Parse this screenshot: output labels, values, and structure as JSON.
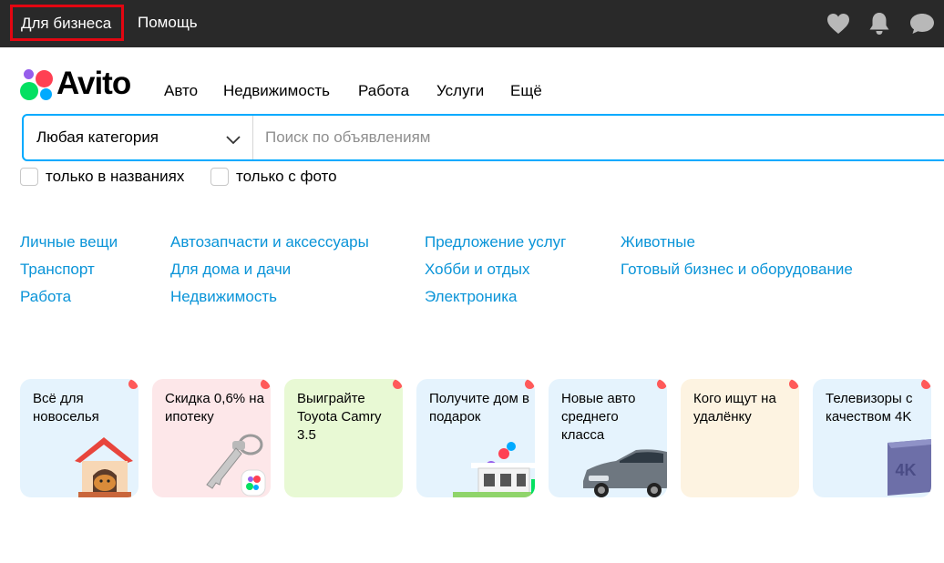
{
  "topbar": {
    "business_link": "Для бизнеса",
    "help_link": "Помощь",
    "icons": [
      "heart-icon",
      "bell-icon",
      "message-icon"
    ]
  },
  "logo": {
    "text": "Avito",
    "dot_colors": [
      "#965eeb",
      "#ff4053",
      "#04e061",
      "#0af"
    ]
  },
  "nav": [
    "Авто",
    "Недвижимость",
    "Работа",
    "Услуги",
    "Ещё"
  ],
  "search": {
    "category": "Любая категория",
    "placeholder": "Поиск по объявлениям"
  },
  "filters": {
    "titles_only": "только в названиях",
    "with_photo": "только с фото"
  },
  "categories": [
    [
      "Личные вещи",
      "Транспорт",
      "Работа"
    ],
    [
      "Автозапчасти и аксессуары",
      "Для дома и дачи",
      "Недвижимость"
    ],
    [
      "Предложение услуг",
      "Хобби и отдых",
      "Электроника"
    ],
    [
      "Животные",
      "Готовый бизнес и оборудование"
    ]
  ],
  "promo_cards": [
    {
      "title": "Всё для новоселья",
      "bg": "#e5f3fd",
      "image": "doghouse-image"
    },
    {
      "title": "Скидка 0,6% на ипотеку",
      "bg": "#fde7e9",
      "image": "keys-image"
    },
    {
      "title": "Выиграйте Toyota Camry 3.5",
      "bg": "#e8f9d4",
      "image": ""
    },
    {
      "title": "Получите дом в подарок",
      "bg": "#e5f3fd",
      "image": "house-image"
    },
    {
      "title": "Новые авто среднего класса",
      "bg": "#e5f3fd",
      "image": "car-image"
    },
    {
      "title": "Кого ищут на удалёнку",
      "bg": "#fdf3e1",
      "image": ""
    },
    {
      "title": "Телевизоры с качеством 4K",
      "bg": "#e5f3fd",
      "image": "tv-4k-image"
    }
  ],
  "tv_label": "4K",
  "colors": {
    "accent": "#00aaff",
    "link": "#0a94d8",
    "topbar": "#292929",
    "highlight": "#e30611"
  }
}
